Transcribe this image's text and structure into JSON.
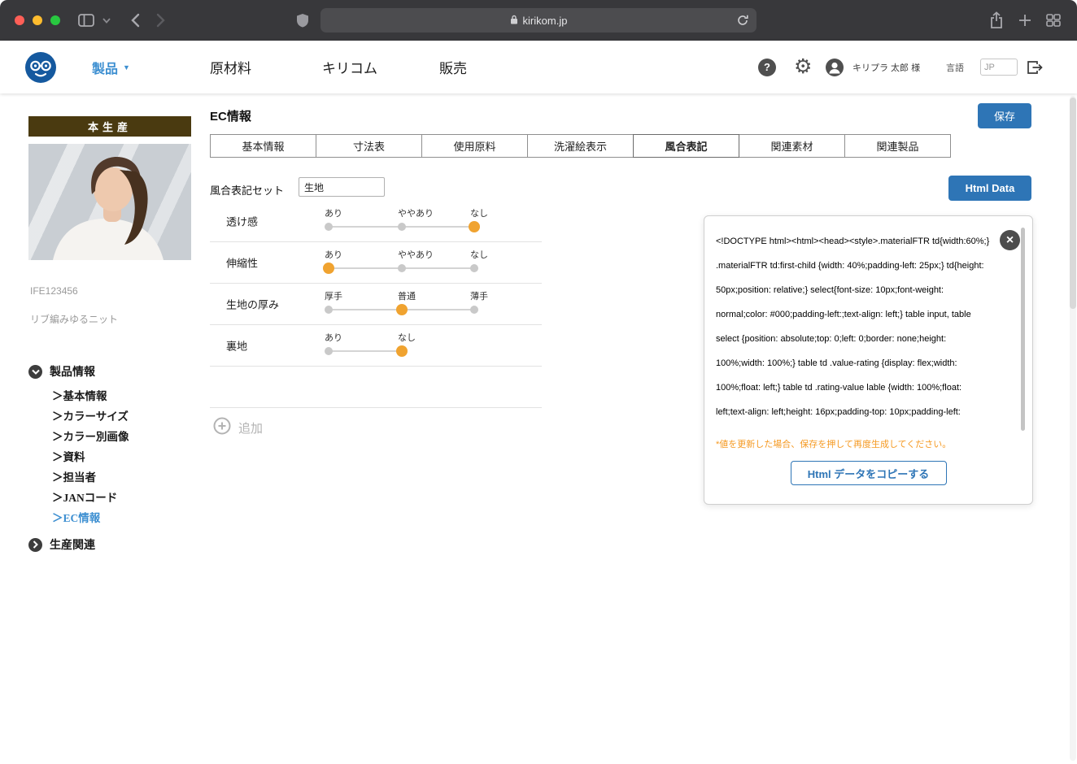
{
  "browser": {
    "url": "kirikom.jp"
  },
  "header": {
    "product_menu_label": "製品",
    "product_menu_caret": "▼",
    "nav_items": [
      "原材料",
      "キリコム",
      "販売"
    ],
    "help_glyph": "?",
    "gear_glyph": "⚙",
    "user_name": "キリプラ 太郎 様",
    "language_label": "言語",
    "language_value": "JP"
  },
  "sidebar": {
    "production_badge": "本生産",
    "product_code": "IFE123456",
    "product_name": "リブ編みゆるニット",
    "section_product_info": "製品情報",
    "section_production": "生産関連",
    "item_prefix": "＞",
    "menu_items": [
      "基本情報",
      "カラーサイズ",
      "カラー別画像",
      "資料",
      "担当者",
      "JANコード",
      "EC情報"
    ],
    "active_item": "EC情報"
  },
  "main": {
    "page_title": "EC情報",
    "save_button": "保存",
    "tabs": [
      "基本情報",
      "寸法表",
      "使用原料",
      "洗濯絵表示",
      "風合表記",
      "関連素材",
      "関連製品"
    ],
    "active_tab": "風合表記",
    "set_label": "風合表記セット",
    "set_value": "生地",
    "html_data_button": "Html Data",
    "ratings": [
      {
        "label": "透け感",
        "options": [
          "あり",
          "ややあり",
          "なし"
        ],
        "selected": 2
      },
      {
        "label": "伸縮性",
        "options": [
          "あり",
          "ややあり",
          "なし"
        ],
        "selected": 0
      },
      {
        "label": "生地の厚み",
        "options": [
          "厚手",
          "普通",
          "薄手"
        ],
        "selected": 1
      },
      {
        "label": "裏地",
        "options": [
          "あり",
          "なし"
        ],
        "selected": 1
      }
    ],
    "add_button_label": "追加"
  },
  "code_panel": {
    "close_glyph": "×",
    "lines": [
      "<!DOCTYPE html><html><head><style>.materialFTR td{width:60%;}",
      ".materialFTR td:first-child {width: 40%;padding-left: 25px;}  td{height:",
      "50px;position: relative;}  select{font-size: 10px;font-weight:",
      "normal;color: #000;padding-left:;text-align: left;}  table input, table",
      "select {position: absolute;top: 0;left: 0;border: none;height:",
      "100%;width: 100%;}  table td .value-rating {display: flex;width:",
      "100%;float: left;}  table td .rating-value lable {width: 100%;float:",
      "left;text-align: left;height: 16px;padding-top: 10px;padding-left:"
    ],
    "warning": "*値を更新した場合、保存を押して再度生成してください。",
    "copy_button": "Html データをコピーする"
  },
  "colors": {
    "accent_blue": "#2e75b6",
    "link_blue": "#3d8fd1",
    "selected_orange": "#f0a330",
    "warning_orange": "#f59a23",
    "badge_brown": "#4a3a10"
  }
}
